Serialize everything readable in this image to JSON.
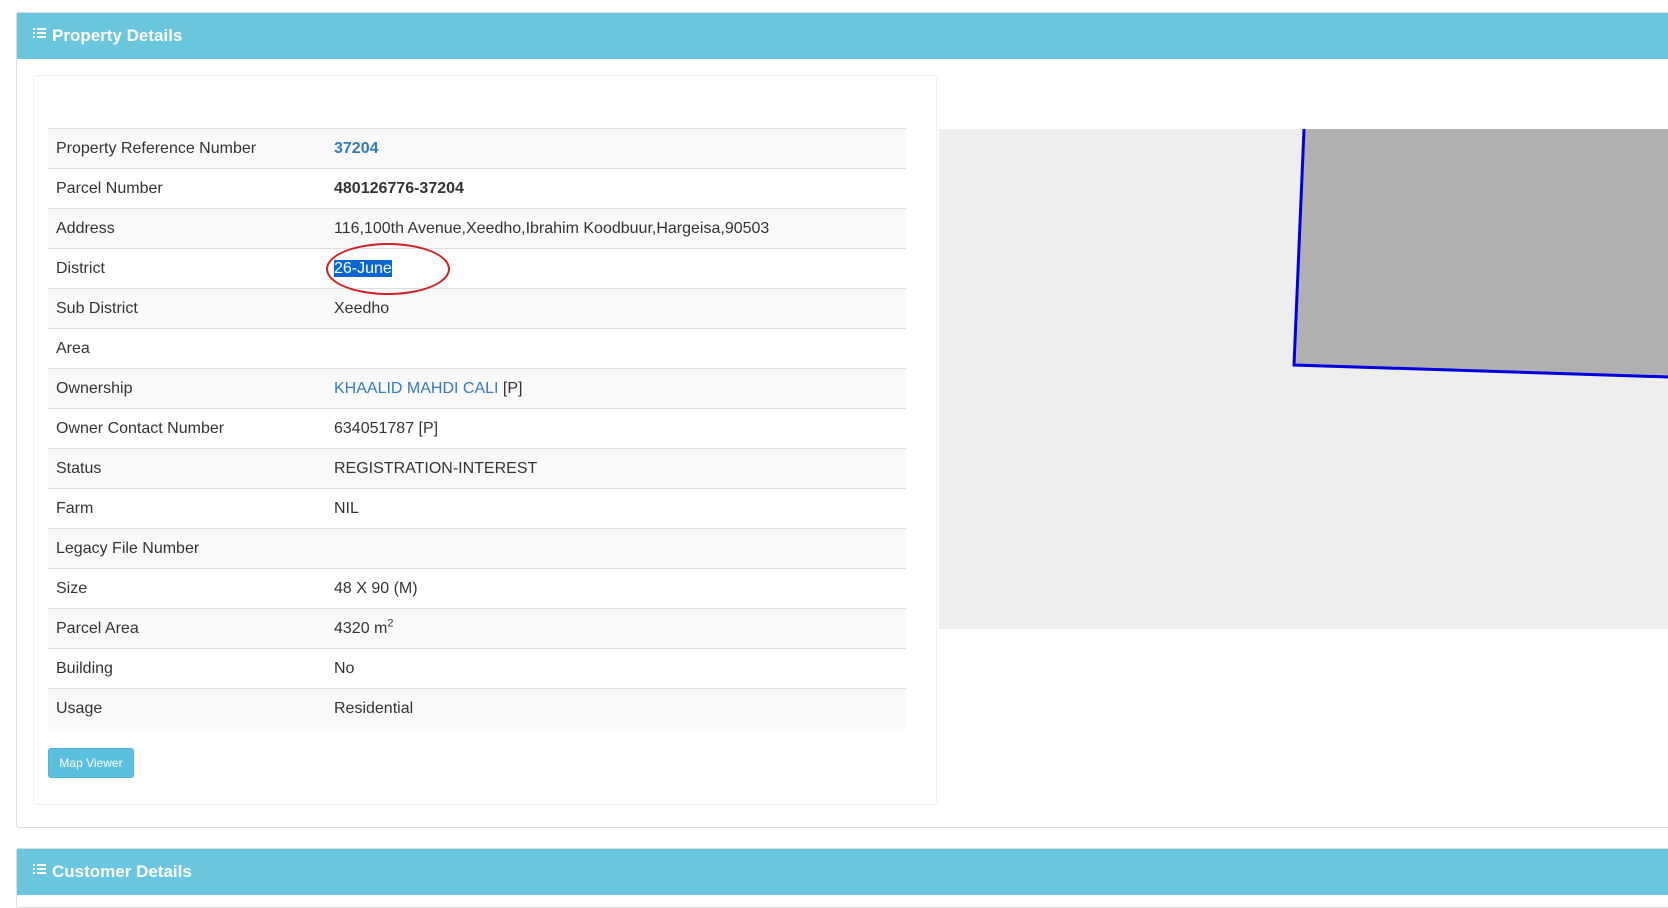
{
  "property_panel": {
    "title": "Property Details",
    "icon": "list-icon",
    "rows": [
      {
        "label": "Property Reference Number",
        "value": "37204"
      },
      {
        "label": "Parcel Number",
        "value": "480126776-37204"
      },
      {
        "label": "Address",
        "value": "116,100th Avenue,Xeedho,Ibrahim Koodbuur,Hargeisa,90503"
      },
      {
        "label": "District",
        "value": "26-June"
      },
      {
        "label": "Sub District",
        "value": "Xeedho"
      },
      {
        "label": "Area",
        "value": ""
      },
      {
        "label": "Ownership",
        "value": "KHAALID MAHDI CALI",
        "suffix": " [P]"
      },
      {
        "label": "Owner Contact Number",
        "value": "634051787 [P]"
      },
      {
        "label": "Status",
        "value": "REGISTRATION-INTEREST"
      },
      {
        "label": "Farm",
        "value": "NIL"
      },
      {
        "label": "Legacy File Number",
        "value": ""
      },
      {
        "label": "Size",
        "value": "48 X 90 (M)"
      },
      {
        "label": "Parcel Area",
        "value": "4320 m",
        "sup": "2"
      },
      {
        "label": "Building",
        "value": "No"
      },
      {
        "label": "Usage",
        "value": "Residential"
      }
    ],
    "map_button_label": "Map Viewer"
  },
  "customer_panel": {
    "title": "Customer Details",
    "icon": "list-icon"
  },
  "colors": {
    "heading_bg": "#6ac5df",
    "link": "#337ab7",
    "parcel_outline": "#0000dd",
    "parcel_fill": "#b0b0b0",
    "annotation": "#d21f26"
  }
}
